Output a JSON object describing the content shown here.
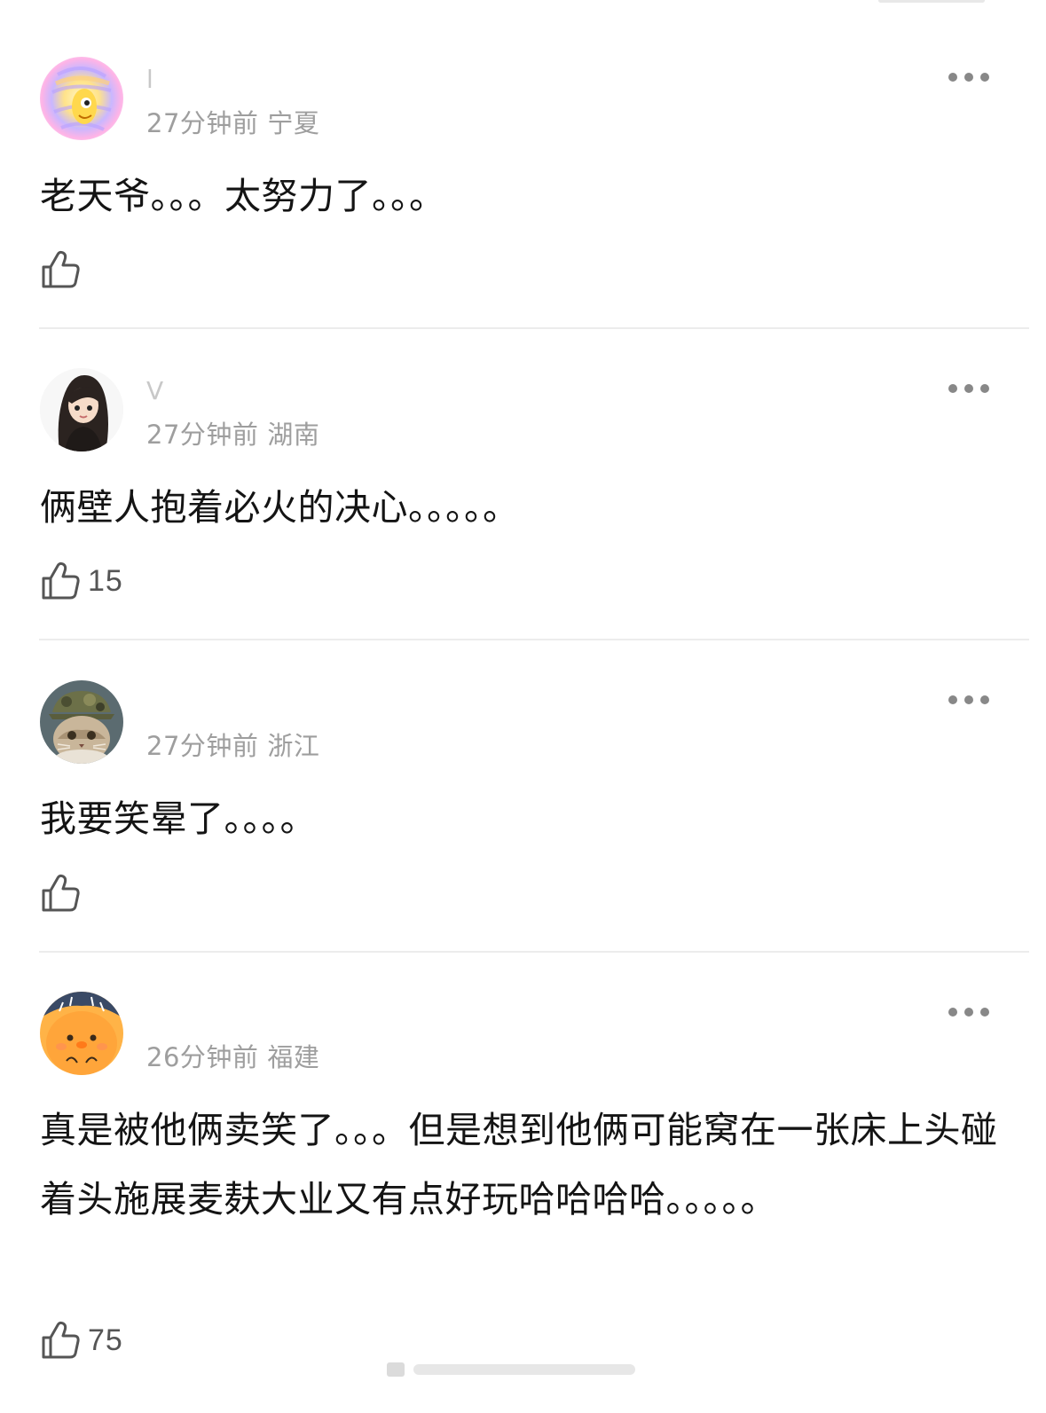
{
  "comments": [
    {
      "username": "l",
      "time": "27分钟前",
      "location": "宁夏",
      "text": "老天爷。。。太努力了。。。",
      "likes": "",
      "avatar": "rainbow-avatar"
    },
    {
      "username": "V",
      "time": "27分钟前",
      "location": "湖南",
      "text": "俩壁人抱着必火的决心。。。。。",
      "likes": "15",
      "avatar": "girl-avatar"
    },
    {
      "username": "",
      "time": "27分钟前",
      "location": "浙江",
      "text": "我要笑晕了。。。。",
      "likes": "",
      "avatar": "cat-avatar"
    },
    {
      "username": "",
      "time": "26分钟前",
      "location": "福建",
      "text": "真是被他俩卖笑了。。。但是想到他俩可能窝在一张床上头碰着头施展麦麸大业又有点好玩哈哈哈哈。。。。。",
      "likes": "75",
      "avatar": "orange-chick-avatar"
    }
  ],
  "icons": {
    "more": "more-options-icon",
    "like": "thumbs-up-icon"
  },
  "colors": {
    "meta": "#9e9e9e",
    "text": "#141414",
    "divider": "#ececec"
  }
}
